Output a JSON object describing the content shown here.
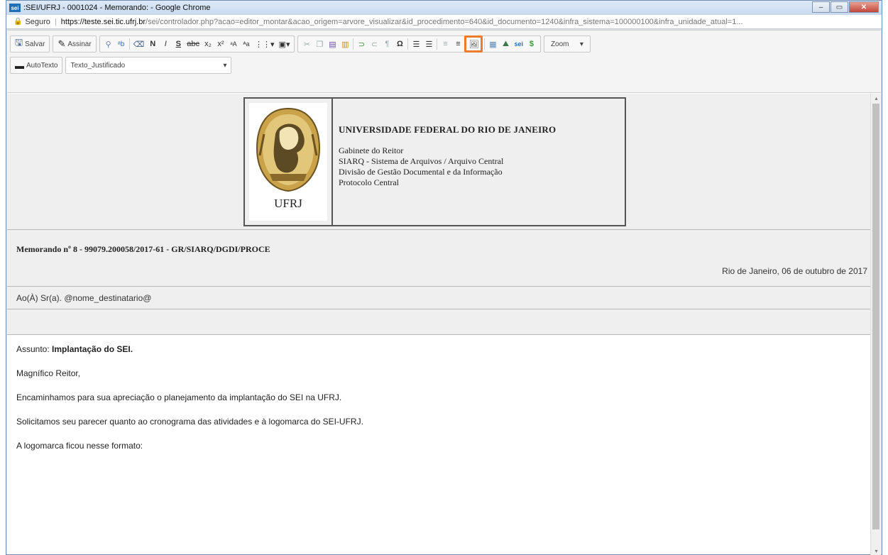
{
  "window": {
    "title": ":SEI/UFRJ - 0001024 - Memorando: - Google Chrome",
    "favicon_label": "sei"
  },
  "address": {
    "secure_label": "Seguro",
    "url_host": "https://teste.sei.tic.ufrj.br",
    "url_rest": "/sei/controlador.php?acao=editor_montar&acao_origem=arvore_visualizar&id_procedimento=640&id_documento=1240&infra_sistema=100000100&infra_unidade_atual=1..."
  },
  "toolbar": {
    "save_label": "Salvar",
    "sign_label": "Assinar",
    "zoom_label": "Zoom",
    "autotext_label": "AutoTexto",
    "style_value": "Texto_Justificado",
    "format_buttons": [
      "N",
      "I",
      "S"
    ],
    "highlighted_button": "image-icon"
  },
  "letterhead": {
    "crest_caption": "UFRJ",
    "title": "UNIVERSIDADE FEDERAL DO RIO DE JANEIRO",
    "lines": [
      "Gabinete do Reitor",
      "SIARQ - Sistema de Arquivos / Arquivo Central",
      "Divisão de Gestão Documental e da Informação",
      "Protocolo Central"
    ]
  },
  "memo": {
    "title": "Memorando nº 8 - 99079.200058/2017-61 - GR/SIARQ/DGDI/PROCE",
    "date": "Rio de Janeiro, 06 de outubro de 2017",
    "recipient": "Ao(À) Sr(a). @nome_destinatario@"
  },
  "body": {
    "subject_prefix": "Assunto: ",
    "subject": "Implantação do SEI.",
    "greeting": "Magnífico Reitor,",
    "p1": "Encaminhamos para sua apreciação o planejamento da implantação do SEI na UFRJ.",
    "p2": "Solicitamos seu parecer quanto ao cronograma das atividades e à logomarca do SEI-UFRJ.",
    "p3": "A logomarca ficou nesse formato:"
  },
  "colors": {
    "highlight": "#ec7c2c",
    "band": "#efefef"
  }
}
